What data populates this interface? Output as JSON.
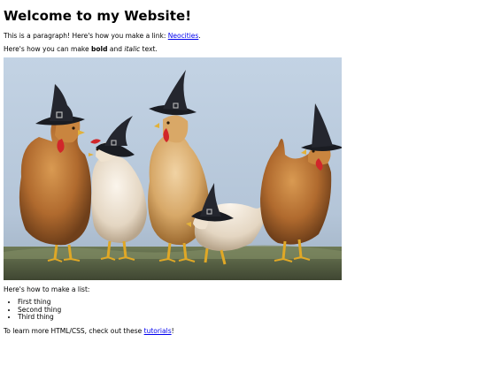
{
  "heading": "Welcome to my Website!",
  "intro": {
    "text_before": "This is a paragraph! Here's how you make a link: ",
    "link_label": "Neocities",
    "text_after": "."
  },
  "formatting": {
    "text_1": "Here's how you can make ",
    "bold": "bold",
    "text_2": " and ",
    "italic": "italic",
    "text_3": " text."
  },
  "image": {
    "alt": "chickens wearing witch hats"
  },
  "list": {
    "intro": "Here's how to make a list:",
    "items": [
      "First thing",
      "Second thing",
      "Third thing"
    ]
  },
  "outro": {
    "text_before": "To learn more HTML/CSS, check out these ",
    "link_label": "tutorials",
    "text_after": "!"
  }
}
